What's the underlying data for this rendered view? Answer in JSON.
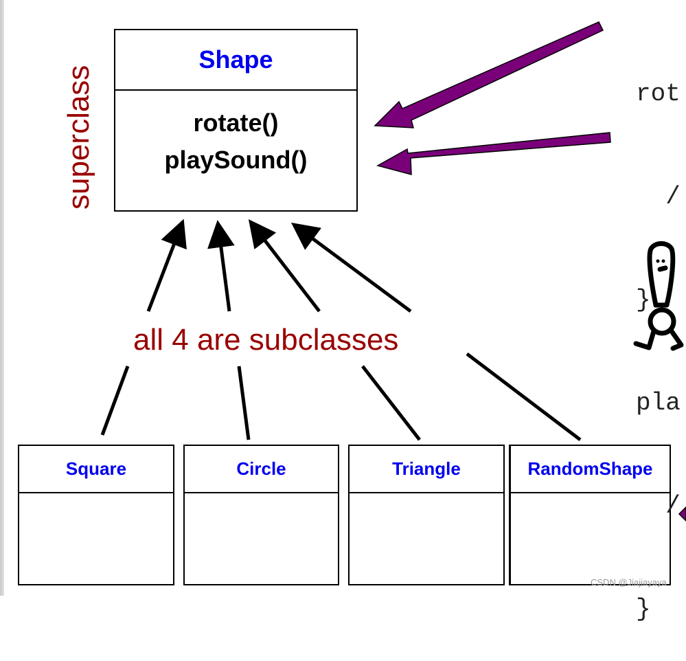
{
  "diagram": {
    "superclass": {
      "name": "Shape",
      "methods": [
        "rotate()",
        "playSound()"
      ],
      "side_label": "superclass"
    },
    "subclasses": [
      {
        "name": "Square"
      },
      {
        "name": "Circle"
      },
      {
        "name": "Triangle"
      },
      {
        "name": "RandomShape"
      }
    ],
    "subclasses_label": "all 4 are subclasses",
    "code_snippet": {
      "lines": [
        "rot",
        "  /",
        "}",
        "pla",
        "  /",
        "}"
      ]
    },
    "colors": {
      "class_name": "#0000ee",
      "annotation": "#990000",
      "override_arrow": "#7a007a",
      "inheritance_arrow": "#000000"
    }
  },
  "watermark": "CSDN @Jiajiayaya"
}
